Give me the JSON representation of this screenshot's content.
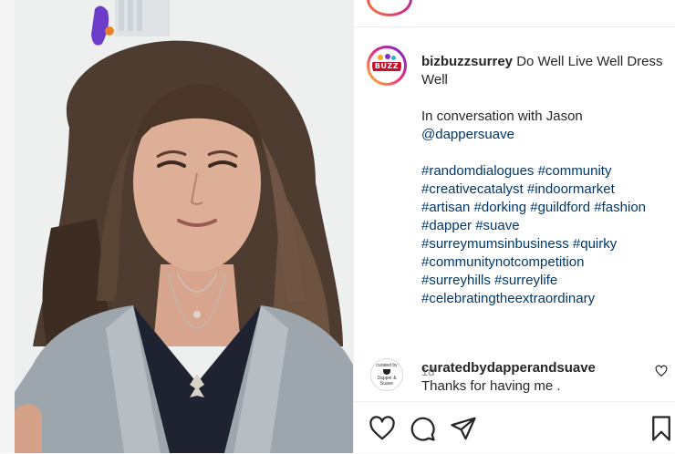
{
  "post": {
    "username": "bizbuzzsurrey",
    "avatar_logo_text": "BUZZ",
    "caption_title": "Do Well Live Well Dress Well",
    "caption_line2": "In conversation with Jason",
    "mention": "@dappersuave",
    "hashtag_lines": [
      "#randomdialogues #community",
      "#creativecatalyst #indoormarket",
      "#artisan #dorking #guildford #fashion",
      "#dapper #suave",
      "#surreymumsinbusiness #quirky",
      "#communitynotcompetition",
      "#surreyhills #surreylife",
      "#celebratingtheextraordinary"
    ],
    "time_ago": "1d"
  },
  "comment": {
    "username": "curatedbydapperandsuave",
    "text": "Thanks for having me .",
    "avatar_text_top": "curated by",
    "avatar_text_bottom": "Dapper & Suave"
  },
  "actions": {
    "like_icon": "heart-icon",
    "comment_icon": "comment-icon",
    "share_icon": "share-icon",
    "save_icon": "bookmark-icon"
  },
  "colors": {
    "link": "#00376b",
    "text": "#262626",
    "muted": "#8e8e8e"
  }
}
